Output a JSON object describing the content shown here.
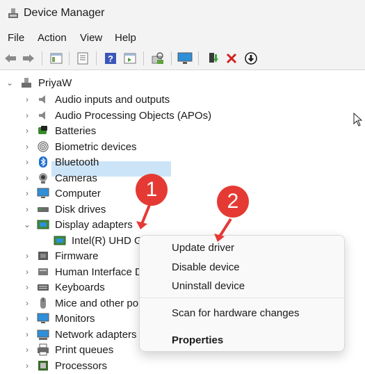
{
  "window": {
    "title": "Device Manager"
  },
  "menu": [
    "File",
    "Action",
    "View",
    "Help"
  ],
  "toolbar_icons": [
    "back-icon",
    "forward-icon",
    "show-hide-tree-icon",
    "properties-icon",
    "help-icon",
    "view-icon",
    "scan-hardware-icon",
    "monitor-icon",
    "update-driver-icon",
    "uninstall-icon",
    "download-icon"
  ],
  "tree": {
    "root": "PriyaW",
    "nodes": [
      {
        "label": "Audio inputs and outputs",
        "icon": "speaker-icon"
      },
      {
        "label": "Audio Processing Objects (APOs)",
        "icon": "speaker-icon"
      },
      {
        "label": "Batteries",
        "icon": "battery-icon"
      },
      {
        "label": "Biometric devices",
        "icon": "fingerprint-icon"
      },
      {
        "label": "Bluetooth",
        "icon": "bluetooth-icon"
      },
      {
        "label": "Cameras",
        "icon": "camera-icon"
      },
      {
        "label": "Computer",
        "icon": "computer-icon"
      },
      {
        "label": "Disk drives",
        "icon": "disk-icon"
      },
      {
        "label": "Display adapters",
        "icon": "display-adapter-icon",
        "expanded": true
      },
      {
        "label": "Intel(R) UHD Gr",
        "icon": "display-adapter-icon",
        "child": true,
        "selected": true
      },
      {
        "label": "Firmware",
        "icon": "firmware-icon"
      },
      {
        "label": "Human Interface D",
        "icon": "hid-icon"
      },
      {
        "label": "Keyboards",
        "icon": "keyboard-icon"
      },
      {
        "label": "Mice and other po",
        "icon": "mouse-icon"
      },
      {
        "label": "Monitors",
        "icon": "monitor-icon"
      },
      {
        "label": "Network adapters",
        "icon": "network-icon"
      },
      {
        "label": "Print queues",
        "icon": "printer-icon"
      },
      {
        "label": "Processors",
        "icon": "processor-icon"
      }
    ]
  },
  "context_menu": {
    "items": [
      "Update driver",
      "Disable device",
      "Uninstall device",
      "Scan for hardware changes",
      "Properties"
    ]
  },
  "annotations": [
    "1",
    "2"
  ],
  "colors": {
    "selection": "#cce4f7",
    "badge": "#e53a34"
  }
}
